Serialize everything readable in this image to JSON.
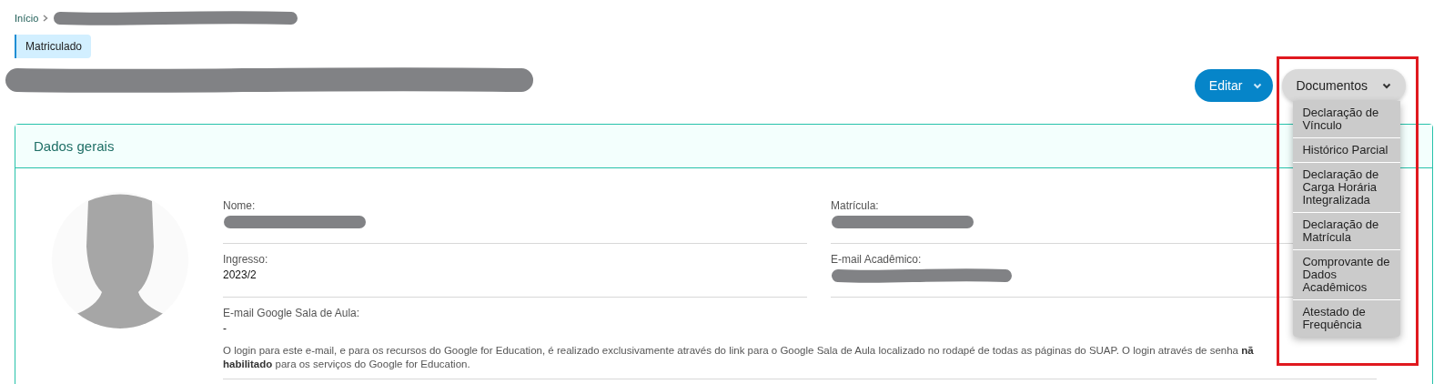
{
  "breadcrumb": {
    "items": [
      {
        "label": "Início"
      }
    ],
    "current_redacted": true
  },
  "status_badge": {
    "label": "Matriculado"
  },
  "title": {
    "redacted": true
  },
  "actions": [
    {
      "label": "Editar",
      "kind": "primary",
      "expanded": false
    },
    {
      "label": "Documentos",
      "kind": "secondary",
      "expanded": true,
      "menu": [
        "Declaração de Vínculo",
        "Histórico Parcial",
        "Declaração de Carga Horária Integralizada",
        "Declaração de Matrícula",
        "Comprovante de Dados Acadêmicos",
        "Atestado de Frequência"
      ]
    }
  ],
  "annotation": {
    "kind": "highlight",
    "color": "#e0191f"
  },
  "card": {
    "title": "Dados gerais",
    "fields": [
      {
        "label": "Nome:",
        "redacted": true
      },
      {
        "label": "Matrícula:",
        "redacted": true
      },
      {
        "label": "Ingresso:",
        "value": "2023/2",
        "redacted": false
      },
      {
        "label": "E-mail Acadêmico:",
        "redacted": true
      },
      {
        "label": "E-mail Google Sala de Aula:",
        "value": "-",
        "redacted": false,
        "note": [
          "O login para este e-mail, e para os recursos do Google for Education, é realizado exclusivamente através do link para o Google Sala de Aula localizado no rodapé de todas as páginas do SUAP. O login através de senha **nã**",
          "**habilitado** para os serviços do Google for Education."
        ]
      }
    ]
  }
}
